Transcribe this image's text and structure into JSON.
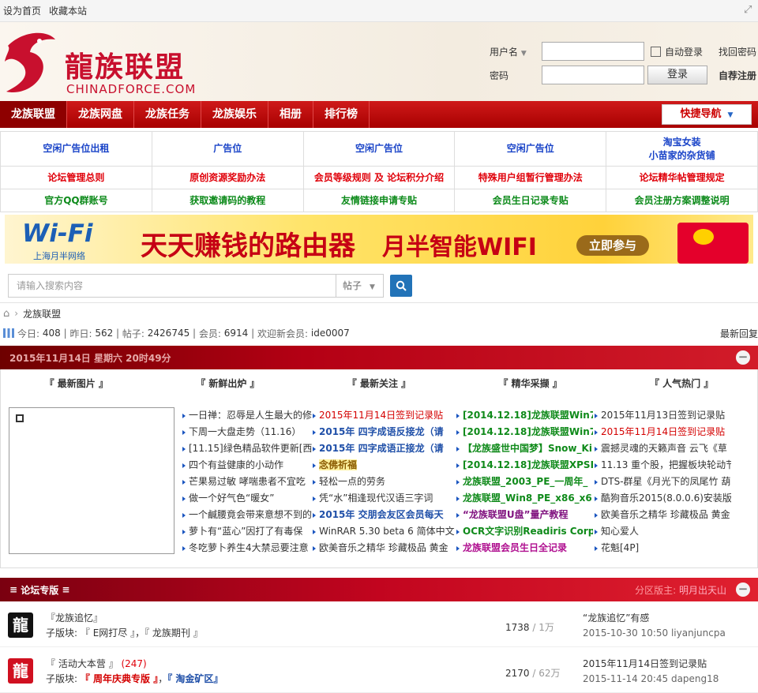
{
  "topbar": {
    "set_home": "设为首页",
    "bookmark": "收藏本站"
  },
  "logo": {
    "brand": "龍族联盟",
    "domain": "CHINADFORCE.COM"
  },
  "login": {
    "username_label": "用户名",
    "password_label": "密码",
    "auto_login": "自动登录",
    "login_button": "登录",
    "forgot": "找回密码",
    "register": "自荐注册"
  },
  "nav": {
    "items": [
      "龙族联盟",
      "龙族网盘",
      "龙族任务",
      "龙族娱乐",
      "相册",
      "排行榜"
    ],
    "quick": "快捷导航"
  },
  "ads": {
    "row1": [
      "空闲广告位出租",
      "广告位",
      "空闲广告位",
      "空闲广告位",
      "淘宝女装",
      "小苗家的杂货铺"
    ],
    "row2": [
      "论坛管理总则",
      "原创资源奖励办法",
      "会员等级规则 及 论坛积分介绍",
      "特殊用户组暂行管理办法",
      "论坛精华帖管理规定"
    ],
    "row3": [
      "官方QQ群账号",
      "获取邀请码的教程",
      "友情链接申请专贴",
      "会员生日记录专贴",
      "会员注册方案调整说明"
    ]
  },
  "banner": {
    "wifi": "Wi-Fi",
    "wifi_sub": "上海月半网络",
    "slogan": "天天赚钱的路由器",
    "slogan2": "月半智能WIFI",
    "join": "立即参与"
  },
  "search": {
    "placeholder": "请输入搜索内容",
    "type": "帖子"
  },
  "crumb": {
    "home": "龙族联盟"
  },
  "stats": {
    "today_label": "今日:",
    "today": "408",
    "yesterday_label": "昨日:",
    "yesterday": "562",
    "posts_label": "帖子:",
    "posts": "2426745",
    "members_label": "会员:",
    "members": "6914",
    "welcome_label": "欢迎新会员:",
    "newest": "ide0007",
    "latest_reply": "最新回复"
  },
  "datebar": {
    "date": "2015年11月14日 星期六 20时49分"
  },
  "feed": {
    "headers": [
      "『 最新图片 』",
      "『 新鲜出炉 』",
      "『 最新关注 』",
      "『 精华采撷 』",
      "『 人气热门 』"
    ],
    "col2": [
      "一日禅：忍辱是人生最大的修",
      "下周一大盘走势（11.16）",
      "[11.15]绿色精品软件更新[西",
      "四个有益健康的小动作",
      "芒果易过敏 哮喘患者不宜吃",
      "做一个好气色“暖女”",
      "一个鹹腰竟会带来意想不到的",
      "萝卜有“蓝心”因打了有毒保",
      "冬吃萝卜养生4大禁忌要注意"
    ],
    "col3": [
      "2015年11月14日签到记录贴",
      "2015年 四字成语反接龙（请",
      "2015年 四字成语正接龙（请",
      "念佛祈福",
      "轻松一点的劳务",
      "凭“水”相逢现代汉语三字词",
      "2015年 交朋会友区会员每天",
      "WinRAR 5.30 beta 6 简体中文",
      "欧美音乐之精华 珍藏极品 黄金"
    ],
    "col4": [
      "[2014.12.18]龙族联盟Win7",
      "[2014.12.18]龙族联盟Win7",
      "【龙族盛世中国梦】Snow_Ki",
      "[2014.12.18]龙族联盟XPSP",
      "龙族联盟_2003_PE_一周年_",
      "龙族联盟_Win8_PE_x86_x6",
      "“龙族联盟U盘”量产教程",
      "OCR文字识别Readiris Corpo",
      "龙族联盟会员生日全记录"
    ],
    "col5": [
      "2015年11月13日签到记录贴",
      "2015年11月14日签到记录贴",
      "震撼灵魂的天籁声音 云飞《草",
      "11.13 重个股，把握板块轮动节",
      "DTS-群星《月光下的凤尾竹 葫",
      "酷狗音乐2015(8.0.0.6)安装版",
      "欧美音乐之精华 珍藏极品 黄金",
      "知心爱人",
      "花魁[4P]"
    ]
  },
  "forum_section": {
    "title": "论坛专版",
    "mod_label": "分区版主:",
    "mod_name": "明月出天山"
  },
  "forums": [
    {
      "name": "『龙族追忆』",
      "count": "",
      "subs_label": "子版块:",
      "sub1": "『 E网打尽 』",
      "sub2": "『 龙族期刊 』",
      "threads": "1738",
      "posts": "1万",
      "last_title": "“龙族追忆”有感",
      "last_time": "2015-10-30 10:50 liyanjuncpa"
    },
    {
      "name": "『 活动大本营 』",
      "count": "(247)",
      "subs_label": "子版块:",
      "sub1": "『 周年庆典专版 』",
      "sub2": "『 淘金矿区』",
      "threads": "2170",
      "posts": "62万",
      "last_title": "2015年11月14日签到记录贴",
      "last_time": "2015-11-14 20:45 dapeng18"
    }
  ]
}
